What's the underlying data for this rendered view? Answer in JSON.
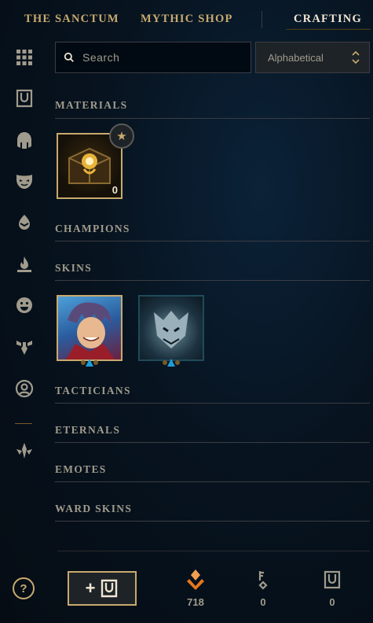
{
  "nav": {
    "tabs": [
      {
        "label": "THE SANCTUM",
        "active": false
      },
      {
        "label": "MYTHIC SHOP",
        "active": false
      },
      {
        "label": "CRAFTING",
        "active": true
      }
    ]
  },
  "sidebar": {
    "icons": [
      "grid-icon",
      "chest-icon",
      "helmet-icon",
      "mask-icon",
      "egg-icon",
      "flame-icon",
      "smiley-icon",
      "ward-icon",
      "profile-icon",
      "tft-icon"
    ]
  },
  "search": {
    "placeholder": "Search",
    "value": ""
  },
  "sort": {
    "selected": "Alphabetical"
  },
  "sections": {
    "materials": "MATERIALS",
    "champions": "CHAMPIONS",
    "skins": "SKINS",
    "tacticians": "TACTICIANS",
    "eternals": "ETERNALS",
    "emotes": "EMOTES",
    "ward_skins": "WARD SKINS"
  },
  "materials": [
    {
      "count": "0"
    }
  ],
  "footer": {
    "help_label": "?",
    "add_label": "+",
    "essence": "718",
    "keys": "0",
    "chests": "0"
  },
  "colors": {
    "gold": "#c8aa6e",
    "text": "#a09b8c",
    "essence": "#e6781e"
  }
}
